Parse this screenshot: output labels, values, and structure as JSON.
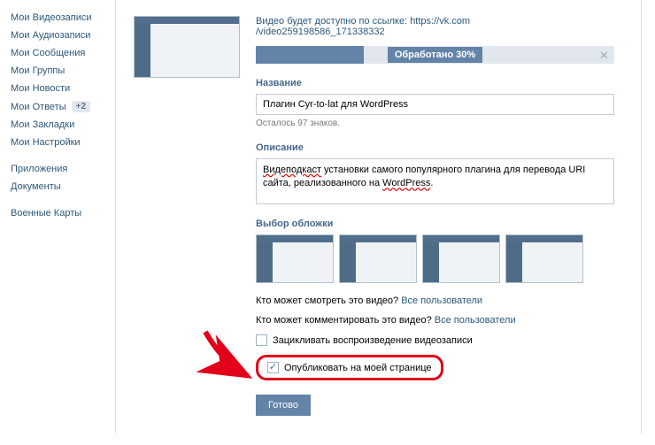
{
  "sidebar": {
    "items": [
      {
        "label": "Мои Видеозаписи"
      },
      {
        "label": "Мои Аудиозаписи"
      },
      {
        "label": "Мои Сообщения"
      },
      {
        "label": "Мои Группы"
      },
      {
        "label": "Мои Новости"
      },
      {
        "label": "Мои Ответы",
        "badge": "+2"
      },
      {
        "label": "Мои Закладки"
      },
      {
        "label": "Мои Настройки"
      }
    ],
    "items2": [
      {
        "label": "Приложения"
      },
      {
        "label": "Документы"
      }
    ],
    "items3": [
      {
        "label": "Военные Карты"
      }
    ]
  },
  "upload": {
    "link_prefix": "Видео будет доступно по ссылке: ",
    "link_host": "https://vk.com",
    "link_path": "/video259198586_171338332",
    "progress_label": "Обработано 30%",
    "progress_pct": 30
  },
  "form": {
    "title_label": "Название",
    "title_value": "Плагин Cyr-to-lat для WordPress",
    "title_hint": "Осталось 97 знаков.",
    "desc_label": "Описание",
    "desc_value_plain": "Видеподкаст установки самого популярного плагина для перевода URI сайта, реализованного на WordPress.",
    "desc_parts": {
      "w1": "Видеподкаст",
      "t1": " установки самого популярного плагина для перевода URI сайта, реализованного на ",
      "w2": "WordPress",
      "t2": "."
    },
    "cover_label": "Выбор обложки",
    "perm_view_q": "Кто может смотреть это видео? ",
    "perm_view_a": "Все пользователи",
    "perm_comment_q": "Кто может комментировать это видео? ",
    "perm_comment_a": "Все пользователи",
    "loop_label": "Зацикливать воспроизведение видеозаписи",
    "publish_label": "Опубликовать на моей странице",
    "submit": "Готово"
  }
}
